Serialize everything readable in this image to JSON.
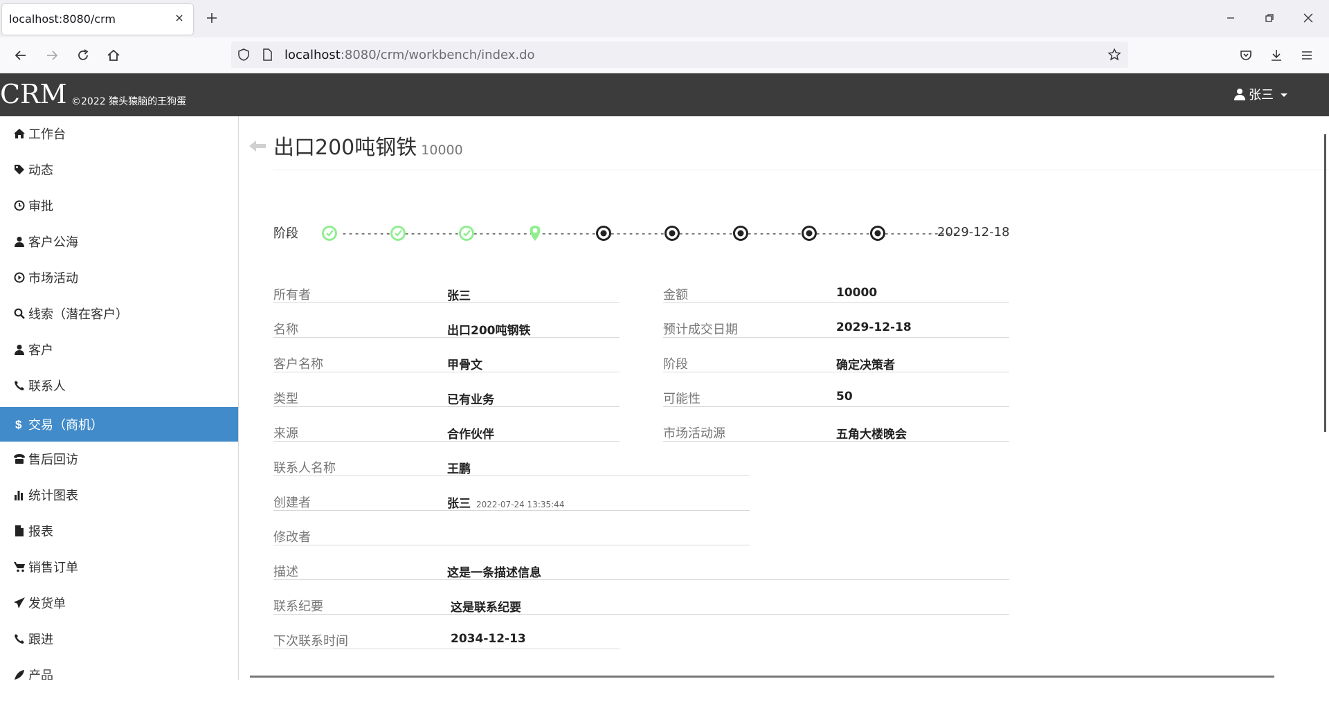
{
  "browser": {
    "tab_title": "localhost:8080/crm",
    "url_host": "localhost",
    "url_rest": ":8080/crm/workbench/index.do"
  },
  "header": {
    "brand": "CRM",
    "copyright": "©2022 猿头猿脑的王狗蛋",
    "user": "张三"
  },
  "sidebar": {
    "items": [
      {
        "label": "工作台",
        "icon": "home-icon"
      },
      {
        "label": "动态",
        "icon": "tag-icon"
      },
      {
        "label": "审批",
        "icon": "clock-icon"
      },
      {
        "label": "客户公海",
        "icon": "user-icon"
      },
      {
        "label": "市场活动",
        "icon": "play-circle-icon"
      },
      {
        "label": "线索（潜在客户）",
        "icon": "search-icon"
      },
      {
        "label": "客户",
        "icon": "user-icon"
      },
      {
        "label": "联系人",
        "icon": "phone-icon"
      },
      {
        "label": "交易（商机）",
        "icon": "dollar-icon",
        "active": true
      },
      {
        "label": "售后回访",
        "icon": "phone-alt-icon"
      },
      {
        "label": "统计图表",
        "icon": "bar-chart-icon"
      },
      {
        "label": "报表",
        "icon": "file-icon"
      },
      {
        "label": "销售订单",
        "icon": "shopping-cart-icon"
      },
      {
        "label": "发货单",
        "icon": "send-icon"
      },
      {
        "label": "跟进",
        "icon": "phone-icon"
      },
      {
        "label": "产品",
        "icon": "leaf-icon"
      }
    ]
  },
  "detail": {
    "title": "出口200吨钢铁",
    "amount_small": "10000",
    "stage_label": "阶段",
    "stage_date": "2029-12-18",
    "stage_states": [
      "done",
      "done",
      "done",
      "current",
      "pending",
      "pending",
      "pending",
      "pending",
      "pending"
    ],
    "stage_connector": "-----------",
    "fields": {
      "owner_label": "所有者",
      "owner": "张三",
      "amount_label": "金额",
      "amount": "10000",
      "name_label": "名称",
      "name": "出口200吨钢铁",
      "expected_date_label": "预计成交日期",
      "expected_date": "2029-12-18",
      "customer_label": "客户名称",
      "customer": "甲骨文",
      "stage_label": "阶段",
      "stage": "确定决策者",
      "type_label": "类型",
      "type": "已有业务",
      "possibility_label": "可能性",
      "possibility": "50",
      "source_label": "来源",
      "source": "合作伙伴",
      "activity_label": "市场活动源",
      "activity": "五角大楼晚会",
      "contact_label": "联系人名称",
      "contact": "王鹏",
      "creator_label": "创建者",
      "creator": "张三",
      "create_time": "2022-07-24 13:35:44",
      "editor_label": "修改者",
      "editor": "",
      "description_label": "描述",
      "description": "这是一条描述信息",
      "summary_label": "联系纪要",
      "summary": "这是联系纪要",
      "next_contact_label": "下次联系时间",
      "next_contact": "2034-12-13"
    }
  },
  "colors": {
    "header_bg": "#3c3c3c",
    "active_item": "#428bca",
    "stage_done": "#90ee90",
    "stage_pending": "#222222"
  }
}
